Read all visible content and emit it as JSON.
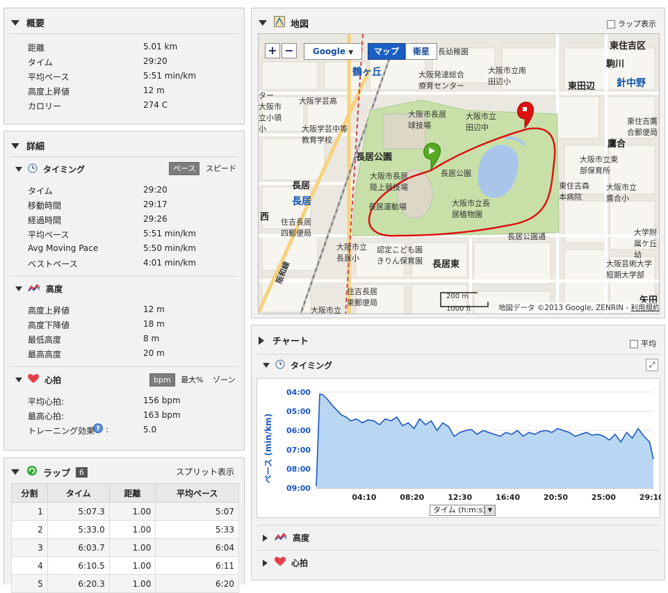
{
  "summary": {
    "title": "概要",
    "rows": [
      {
        "label": "距離",
        "value": "5.01 km"
      },
      {
        "label": "タイム",
        "value": "29:20"
      },
      {
        "label": "平均ペース",
        "value": "5:51 min/km"
      },
      {
        "label": "高度上昇値",
        "value": "12 m"
      },
      {
        "label": "カロリー",
        "value": "274 C"
      }
    ]
  },
  "details": {
    "title": "詳細",
    "timing": {
      "title": "タイミング",
      "toggle_on": "ペース",
      "toggle_off": "スピード",
      "rows": [
        {
          "label": "タイム",
          "value": "29:20"
        },
        {
          "label": "移動時間",
          "value": "29:17"
        },
        {
          "label": "経過時間",
          "value": "29:26"
        },
        {
          "label": "平均ペース",
          "value": "5:51 min/km"
        },
        {
          "label": "Avg Moving Pace",
          "value": "5:50 min/km"
        },
        {
          "label": "ベストペース",
          "value": "4:01 min/km"
        }
      ]
    },
    "elevation": {
      "title": "高度",
      "rows": [
        {
          "label": "高度上昇値",
          "value": "12 m"
        },
        {
          "label": "高度下降値",
          "value": "18 m"
        },
        {
          "label": "最低高度",
          "value": "8 m"
        },
        {
          "label": "最高高度",
          "value": "20 m"
        }
      ]
    },
    "heart": {
      "title": "心拍",
      "toggle_on": "bpm",
      "toggle_mid": "最大%",
      "toggle_off": "ゾーン",
      "rows": [
        {
          "label": "平均心拍:",
          "value": "156 bpm"
        },
        {
          "label": "最高心拍:",
          "value": "163 bpm"
        },
        {
          "label": "トレーニング効果",
          "value": "5.0",
          "suffix": ":"
        }
      ]
    }
  },
  "laps": {
    "title": "ラップ",
    "count": "6",
    "split_label": "スプリット表示",
    "headers": [
      "分割",
      "タイム",
      "距離",
      "平均ペース"
    ],
    "rows": [
      [
        "1",
        "5:07.3",
        "1.00",
        "5:07"
      ],
      [
        "2",
        "5:33.0",
        "1.00",
        "5:33"
      ],
      [
        "3",
        "6:03.7",
        "1.00",
        "6:04"
      ],
      [
        "4",
        "6:10.5",
        "1.00",
        "6:11"
      ],
      [
        "5",
        "6:20.3",
        "1.00",
        "6:20"
      ]
    ]
  },
  "map": {
    "title": "地図",
    "lap_display": "ラップ表示",
    "provider": "Google",
    "btn_map": "マップ",
    "btn_sat": "衛星",
    "scale_m": "200 m",
    "scale_ft": "1000 ft",
    "copyright": "地図データ ©2013 Google, ZENRIN -",
    "terms": "利用規約",
    "labels": {
      "tsurugaoka": "鶴ヶ丘",
      "nagai_park": "長居公園",
      "nagai": "長居",
      "nagai_station": "長居",
      "higashisumiyoshi": "東住吉区",
      "komagawa": "駒川",
      "higashitanabe": "東田辺",
      "harinakano": "針中野",
      "takaai": "鷹合",
      "nagaihigashi": "長居東",
      "nishi": "西",
      "yada": "矢田",
      "kindergarten": "長幼稚園",
      "osaka_center": "大阪発達総合療育センター",
      "minamitanabe": "大阪市立南田辺小",
      "kyugi": "大阪市長居球技場",
      "tanabe_jhs": "大阪市立田辺中",
      "rikujo": "大阪市長居陸上競技場",
      "koen_small": "長居公園",
      "undojo": "長居運動場",
      "shokubutsuen": "大阪市立長居植物園",
      "koendori": "長居公園通",
      "gakugei_high": "大阪学芸高",
      "gakugei_mid": "大阪学芸中等教育学校",
      "post_nagai": "住吉長居四郵便局",
      "nagai_es": "大阪市立長居小",
      "kodomoen": "認定こども園きりん保育園",
      "post_higashi": "住吉長居東郵便局",
      "osaka_es": "大阪市立",
      "hanwa": "阪和線",
      "hoikusho": "大阪市立東部保育所",
      "higashisumiyoshi_post": "東住吉鷹合郵便局",
      "morimoto": "東住吉森本病院",
      "takaai_es": "大阪市立鷹合小",
      "geidai": "大阪芸術大学短期大学部",
      "geidai2": "大阪芸術大学部",
      "kita_center": "ター",
      "left_es": "大阪市立小領小",
      "ta_label": "大学附属ケ丘幼"
    }
  },
  "chart": {
    "title": "チャート",
    "avg_label": "平均",
    "timing_title": "タイミング",
    "elevation_title": "高度",
    "heart_title": "心拍",
    "x_selector": "タイム (h:m:s)"
  },
  "chart_data": {
    "type": "area",
    "ylabel": "ペース (min/km)",
    "y_tick_labels": [
      "04:00",
      "05:00",
      "06:00",
      "07:00",
      "08:00",
      "09:00"
    ],
    "x_tick_labels": [
      "04:10",
      "08:20",
      "12:30",
      "16:40",
      "20:50",
      "25:00",
      "29:10"
    ],
    "ylim": [
      4.0,
      9.0
    ],
    "y_inverted": true,
    "x_unit": "minutes",
    "xlim": [
      0,
      29.33
    ],
    "grid": true,
    "series": [
      {
        "x": [
          0,
          0.3,
          0.6,
          1.0,
          1.4,
          1.8,
          2.2,
          2.6,
          3.0,
          3.5,
          4.0,
          4.5,
          5.0,
          5.5,
          6.0,
          6.5,
          7.0,
          7.5,
          8.0,
          8.5,
          9.0,
          9.5,
          10.0,
          10.5,
          11.0,
          11.5,
          12.0,
          12.5,
          13.0,
          13.5,
          14.0,
          14.5,
          15.0,
          15.5,
          16.0,
          16.5,
          17.0,
          17.5,
          18.0,
          18.5,
          19.0,
          19.5,
          20.0,
          20.5,
          21.0,
          21.5,
          22.0,
          22.5,
          23.0,
          23.5,
          24.0,
          24.5,
          25.0,
          25.5,
          26.0,
          26.5,
          27.0,
          27.5,
          28.0,
          28.5,
          29.0,
          29.33
        ],
        "values": [
          8.9,
          4.1,
          4.15,
          4.4,
          4.7,
          4.95,
          5.2,
          5.3,
          5.5,
          5.4,
          5.6,
          5.45,
          5.5,
          5.7,
          5.4,
          5.5,
          5.3,
          5.75,
          5.6,
          5.9,
          5.4,
          5.7,
          5.5,
          6.0,
          5.6,
          5.8,
          6.3,
          6.1,
          6.0,
          5.95,
          6.2,
          6.0,
          6.1,
          6.2,
          6.3,
          6.1,
          6.2,
          6.0,
          6.3,
          6.1,
          6.2,
          6.05,
          6.0,
          6.1,
          5.9,
          6.0,
          6.1,
          6.3,
          6.2,
          6.1,
          6.25,
          6.2,
          6.3,
          6.5,
          6.2,
          6.6,
          6.1,
          6.4,
          5.9,
          6.3,
          6.6,
          7.5
        ]
      }
    ]
  }
}
